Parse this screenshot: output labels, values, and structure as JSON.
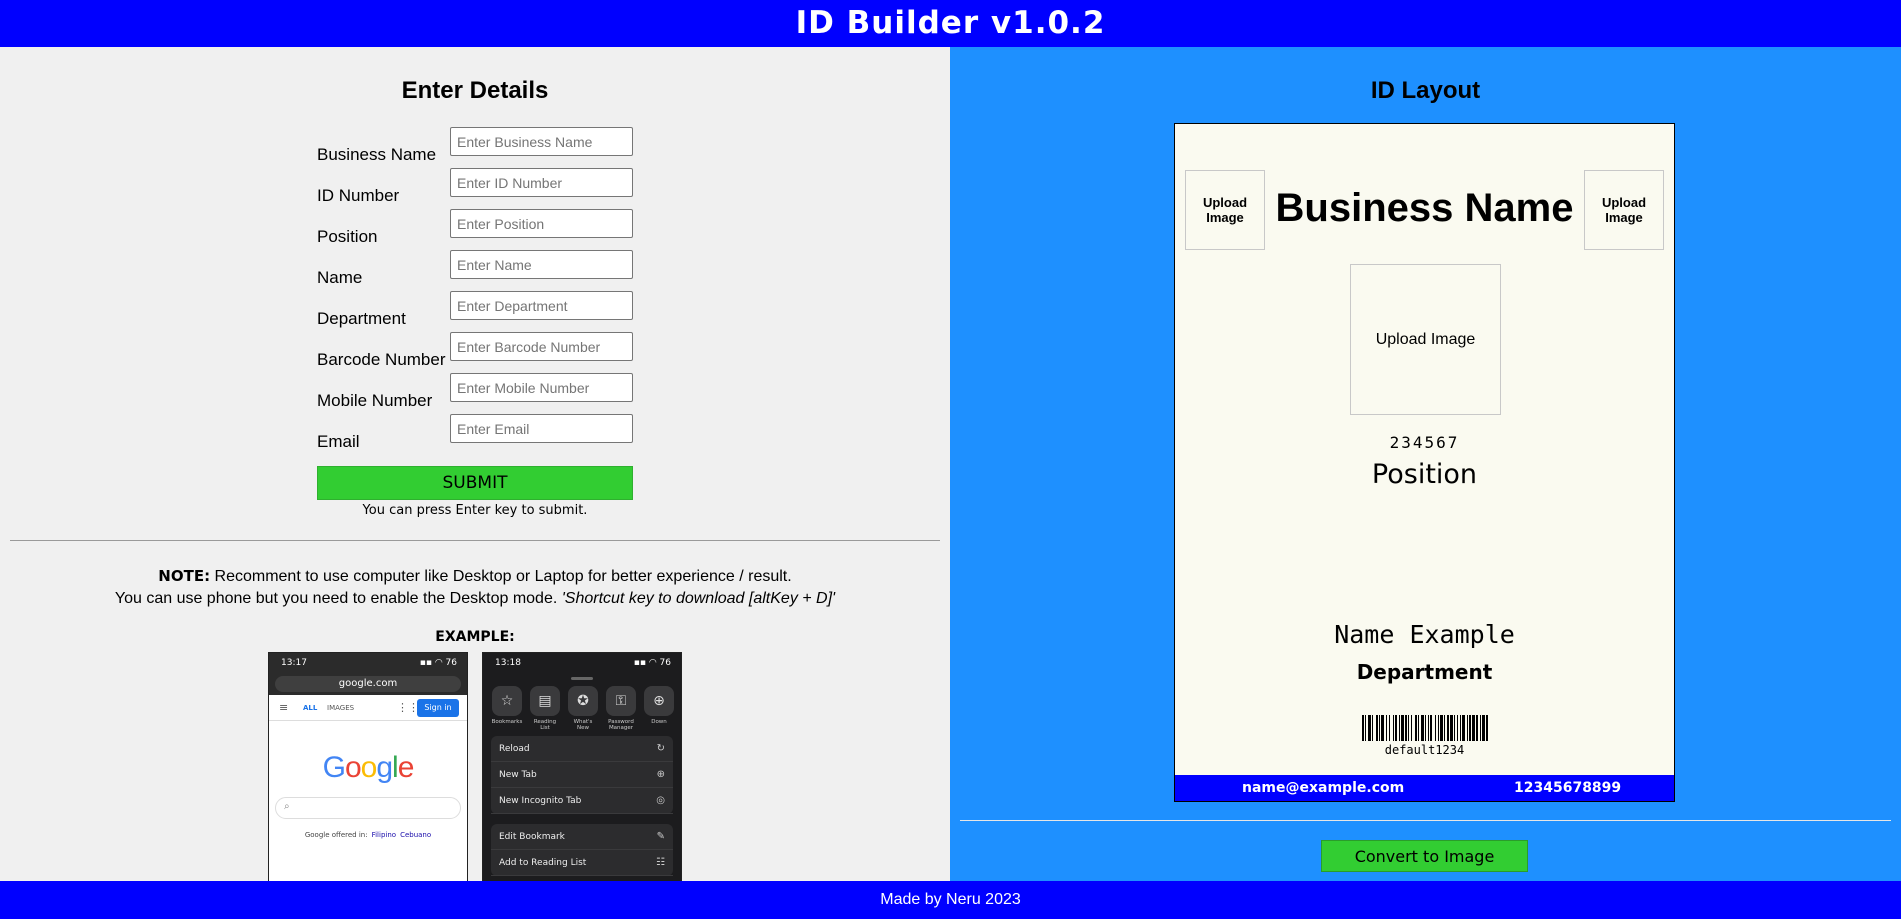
{
  "app": {
    "title": "ID Builder v1.0.2"
  },
  "form": {
    "heading": "Enter Details",
    "fields": [
      {
        "label": "Business Name",
        "placeholder": "Enter Business Name",
        "value": ""
      },
      {
        "label": "ID Number",
        "placeholder": "Enter ID Number",
        "value": ""
      },
      {
        "label": "Position",
        "placeholder": "Enter Position",
        "value": ""
      },
      {
        "label": "Name",
        "placeholder": "Enter Name",
        "value": ""
      },
      {
        "label": "Department",
        "placeholder": "Enter Department",
        "value": ""
      },
      {
        "label": "Barcode Number",
        "placeholder": "Enter Barcode Number",
        "value": ""
      },
      {
        "label": "Mobile Number",
        "placeholder": "Enter Mobile Number",
        "value": ""
      },
      {
        "label": "Email",
        "placeholder": "Enter Email",
        "value": ""
      }
    ],
    "submit_label": "SUBMIT",
    "hint": "You can press Enter key to submit."
  },
  "note": {
    "label": "NOTE:",
    "text": " Recomment to use computer like Desktop or Laptop for better experience / result.",
    "line2": "You can use phone but you need to enable the Desktop mode. ",
    "shortcut": "'Shortcut key to download [altKey + D]'",
    "example_label": "EXAMPLE:"
  },
  "example_phone1": {
    "time": "13:17",
    "status_icons": "▪▪ ◠ 76",
    "url": "google.com",
    "tab_all": "ALL",
    "tab_images": "IMAGES",
    "sign_in": "Sign in",
    "logo": [
      "G",
      "o",
      "o",
      "g",
      "l",
      "e"
    ],
    "offered_in": "Google offered in:",
    "lang1": "Filipino",
    "lang2": "Cebuano"
  },
  "example_phone2": {
    "time": "13:18",
    "status_icons": "▪▪ ◠ 76",
    "icons": [
      {
        "label": "Bookmarks",
        "icon": "star-icon"
      },
      {
        "label": "Reading List",
        "icon": "reading-list-icon"
      },
      {
        "label": "What's New",
        "icon": "whats-new-icon"
      },
      {
        "label": "Password Manager",
        "icon": "key-icon"
      },
      {
        "label": "Down",
        "icon": "download-icon"
      }
    ],
    "menu1": [
      "Reload",
      "New Tab",
      "New Incognito Tab"
    ],
    "menu2": [
      "Edit Bookmark",
      "Add to Reading List"
    ]
  },
  "layout": {
    "heading": "ID Layout",
    "upload_left": "Upload Image",
    "upload_right": "Upload Image",
    "upload_center": "Upload Image",
    "business_name": "Business Name",
    "id_number": "234567",
    "position": "Position",
    "name": "Name Example",
    "department": "Department",
    "barcode_text": "default1234",
    "email": "name@example.com",
    "mobile": "12345678899",
    "convert_label": "Convert to Image"
  },
  "footer": {
    "text": "Made by Neru 2023"
  },
  "colors": {
    "header_blue": "#0000ff",
    "right_panel": "#1e90ff",
    "button_green": "#32cd32",
    "card_bg": "#fafaf0"
  }
}
